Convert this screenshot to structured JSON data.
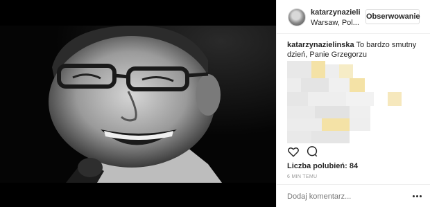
{
  "post": {
    "username": "katarzynazieli",
    "location": "Warsaw, Pol...",
    "follow_label": "Obserwowanie",
    "comment": {
      "author": "katarzynazielinska",
      "text": "To bardzo smutny dzień, Panie Grzegorzu"
    },
    "likes_label": "Liczba polubień: 84",
    "timestamp": "6 MIN TEMU",
    "comment_placeholder": "Dodaj komentarz..."
  },
  "icons": {
    "like": "heart-icon",
    "comment": "speech-bubble-icon",
    "more": "more-options-icon"
  },
  "colors": {
    "border": "#efefef",
    "text": "#262626",
    "muted": "#999999",
    "blur_accent": "#f4e2a6"
  }
}
